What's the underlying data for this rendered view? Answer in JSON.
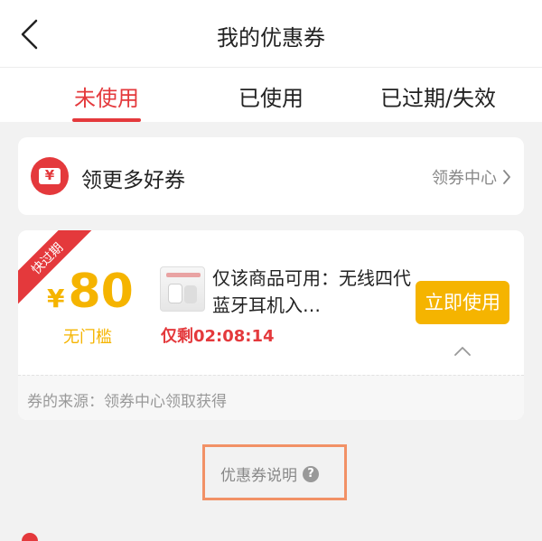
{
  "header": {
    "title": "我的优惠券",
    "back_icon": "chevron-left-icon"
  },
  "tabs": [
    {
      "label": "未使用",
      "active": true
    },
    {
      "label": "已使用",
      "active": false
    },
    {
      "label": "已过期/失效",
      "active": false
    }
  ],
  "more_coupons": {
    "icon": "coupon-yen-icon",
    "icon_glyph": "¥",
    "label": "领更多好券",
    "link_label": "领券中心"
  },
  "coupon": {
    "badge": "快过期",
    "currency": "¥",
    "amount": "80",
    "threshold": "无门槛",
    "product_thumb_icon": "earbuds-product-thumbnail",
    "description": "仅该商品可用：无线四代蓝牙耳机入…",
    "countdown": "仅剩02:08:14",
    "use_button": "立即使用",
    "source": "券的来源：领券中心领取获得"
  },
  "explain": {
    "label": "优惠券说明",
    "help_glyph": "?"
  },
  "colors": {
    "accent_red": "#e4393c",
    "gold": "#f5b400",
    "highlight_box": "#f29166",
    "background": "#f2f2f2"
  }
}
